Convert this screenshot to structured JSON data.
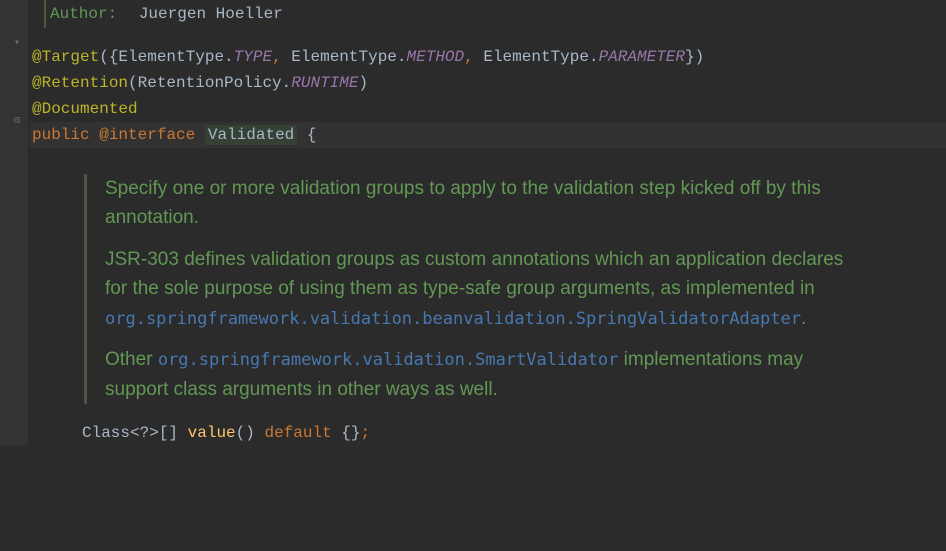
{
  "author": {
    "label": "Author:",
    "name": "Juergen Hoeller"
  },
  "code": {
    "target_anno": "@Target",
    "target_open": "({",
    "elemtype": "ElementType",
    "dot": ".",
    "const_type": "TYPE",
    "comma": ",",
    "const_method": "METHOD",
    "const_parameter": "PARAMETER",
    "target_close": "})",
    "retention_anno": "@Retention",
    "retention_open": "(",
    "retention_policy": "RetentionPolicy",
    "const_runtime": "RUNTIME",
    "retention_close": ")",
    "documented_anno": "@Documented",
    "public_kw": "public",
    "at_kw": "@",
    "interface_kw": "interface",
    "class_name": "Validated",
    "open_brace": "{",
    "value_type": "Class",
    "value_generic": "<?>[]",
    "value_name": "value",
    "value_parens": "()",
    "default_kw": "default",
    "default_val": "{}",
    "semi": ";"
  },
  "javadoc": {
    "p1": "Specify one or more validation groups to apply to the validation step kicked off by this annotation.",
    "p2_a": "JSR-303 defines validation groups as custom annotations which an application declares for the sole purpose of using them as type-safe group arguments, as implemented in ",
    "p2_code": "org.springframework.validation.beanvalidation.SpringValidatorAdapter",
    "p2_b": ".",
    "p3_a": "Other ",
    "p3_code": "org.springframework.validation.SmartValidator",
    "p3_b": " implementations may support class arguments in other ways as well."
  }
}
